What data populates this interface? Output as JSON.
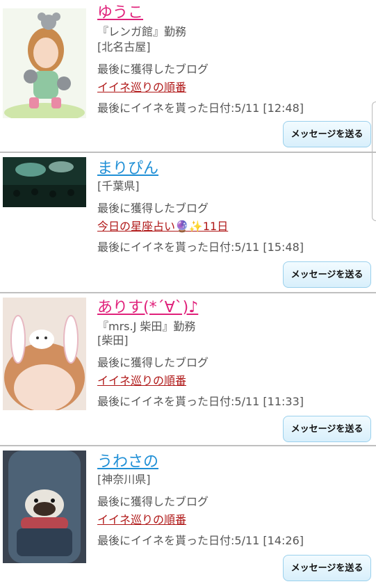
{
  "blog_label": "最後に獲得したブログ",
  "message_button": "メッセージを送る",
  "colors": {
    "name_pink": "#e0207a",
    "name_blue": "#1f8fd6",
    "blog_link": "#b01818",
    "button_fill": "#d8effb"
  },
  "entries": [
    {
      "name": "ゆうこ",
      "workplace": "『レンガ館』勤務",
      "location": "[北名古屋]",
      "blog_title": "イイネ巡りの順番",
      "liked_date": "最後にイイネを貰った日付:5/11 [12:48]"
    },
    {
      "name": "まりぴん",
      "location": "[千葉県]",
      "blog_title": "今日の星座占い🔮✨11日",
      "liked_date": "最後にイイネを貰った日付:5/11 [15:48]"
    },
    {
      "name": "ありす(*´∀`)♪",
      "workplace": "『mrs.J 柴田』勤務",
      "location": "[柴田]",
      "blog_title": "イイネ巡りの順番",
      "liked_date": "最後にイイネを貰った日付:5/11 [11:33]"
    },
    {
      "name": "うわさの",
      "location": "[神奈川県]",
      "blog_title": "イイネ巡りの順番",
      "liked_date": "最後にイイネを貰った日付:5/11 [14:26]"
    }
  ]
}
